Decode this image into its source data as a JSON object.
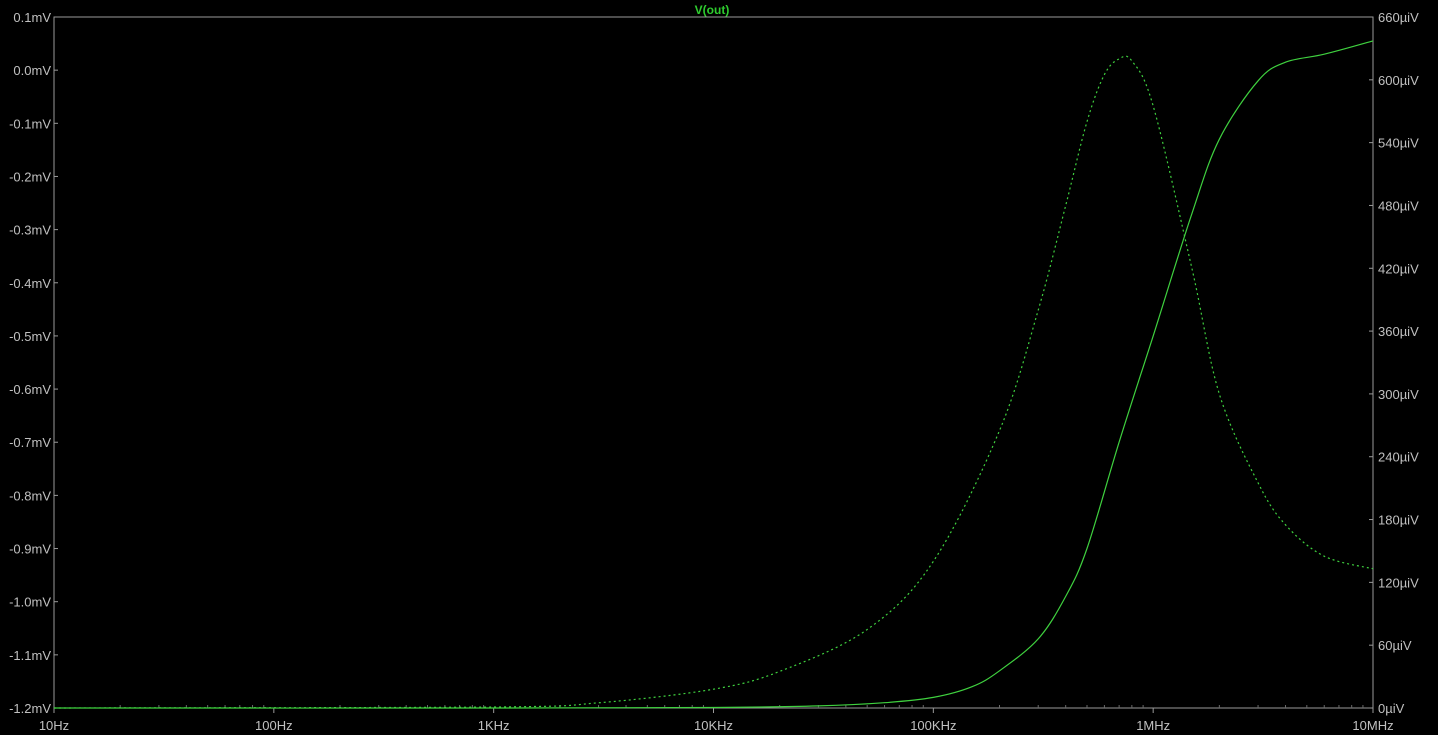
{
  "chart_data": {
    "type": "line",
    "title": "V(out)",
    "x_scale": "log",
    "xlim": [
      10,
      10000000
    ],
    "x_ticks": [
      {
        "value": 10,
        "label": "10Hz"
      },
      {
        "value": 100,
        "label": "100Hz"
      },
      {
        "value": 1000,
        "label": "1KHz"
      },
      {
        "value": 10000,
        "label": "10KHz"
      },
      {
        "value": 100000,
        "label": "100KHz"
      },
      {
        "value": 1000000,
        "label": "1MHz"
      },
      {
        "value": 10000000,
        "label": "10MHz"
      }
    ],
    "y_left": {
      "ylim": [
        -1.2,
        0.1
      ],
      "ticks": [
        "0.1mV",
        "0.0mV",
        "-0.1mV",
        "-0.2mV",
        "-0.3mV",
        "-0.4mV",
        "-0.5mV",
        "-0.6mV",
        "-0.7mV",
        "-0.8mV",
        "-0.9mV",
        "-1.0mV",
        "-1.1mV",
        "-1.2mV"
      ]
    },
    "y_right": {
      "ylim": [
        0,
        660
      ],
      "ticks": [
        "660µiV",
        "600µiV",
        "540µiV",
        "480µiV",
        "420µiV",
        "360µiV",
        "300µiV",
        "240µiV",
        "180µiV",
        "120µiV",
        "60µiV",
        "0µiV"
      ]
    },
    "series": [
      {
        "style": "solid",
        "axis": "left",
        "color": "#3fd13f",
        "x": [
          10,
          1000,
          10000,
          30000,
          60000,
          100000,
          150000,
          200000,
          300000,
          400000,
          500000,
          700000,
          1000000,
          1500000,
          2000000,
          3000000,
          4000000,
          6000000,
          10000000
        ],
        "y": [
          -1.2,
          -1.2,
          -1.199,
          -1.196,
          -1.19,
          -1.18,
          -1.16,
          -1.13,
          -1.07,
          -0.99,
          -0.9,
          -0.7,
          -0.5,
          -0.27,
          -0.13,
          -0.02,
          0.015,
          0.03,
          0.055
        ]
      },
      {
        "style": "dotted",
        "axis": "right",
        "color": "#3fd13f",
        "x": [
          10,
          1000,
          3000,
          10000,
          20000,
          50000,
          100000,
          200000,
          300000,
          400000,
          500000,
          600000,
          700000,
          800000,
          1000000,
          1500000,
          2000000,
          3000000,
          4000000,
          6000000,
          10000000
        ],
        "y": [
          0,
          1,
          5,
          18,
          35,
          75,
          140,
          265,
          380,
          480,
          560,
          605,
          620,
          618,
          575,
          420,
          300,
          215,
          175,
          145,
          133
        ]
      }
    ]
  }
}
